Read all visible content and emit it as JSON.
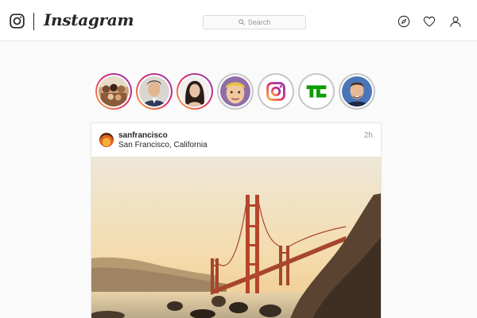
{
  "app": {
    "wordmark": "Instagram",
    "search_placeholder": "Search"
  },
  "nav_icons": [
    "explore-compass",
    "activity-heart",
    "profile-person"
  ],
  "stories": [
    {
      "name": "story-1",
      "ring": "unseen",
      "thumb": "group-photo"
    },
    {
      "name": "story-2",
      "ring": "unseen",
      "thumb": "man-portrait"
    },
    {
      "name": "story-3",
      "ring": "unseen",
      "thumb": "woman-portrait"
    },
    {
      "name": "story-4",
      "ring": "seen",
      "thumb": "face-closeup"
    },
    {
      "name": "story-5",
      "ring": "seen",
      "thumb": "instagram-logo"
    },
    {
      "name": "story-6",
      "ring": "seen",
      "thumb": "techcrunch-logo"
    },
    {
      "name": "story-7",
      "ring": "seen",
      "thumb": "man-portrait-blue"
    }
  ],
  "post": {
    "username": "sanfrancisco",
    "location": "San Francisco, California",
    "time": "2h",
    "image_subject": "Golden Gate Bridge at sunset"
  },
  "colors": {
    "border": "#e6e6e6",
    "story_gradient": [
      "#f9b33a",
      "#e1306c",
      "#8a3ab9"
    ],
    "bridge": "#b5462a",
    "techcrunch": "#0a9e01"
  }
}
